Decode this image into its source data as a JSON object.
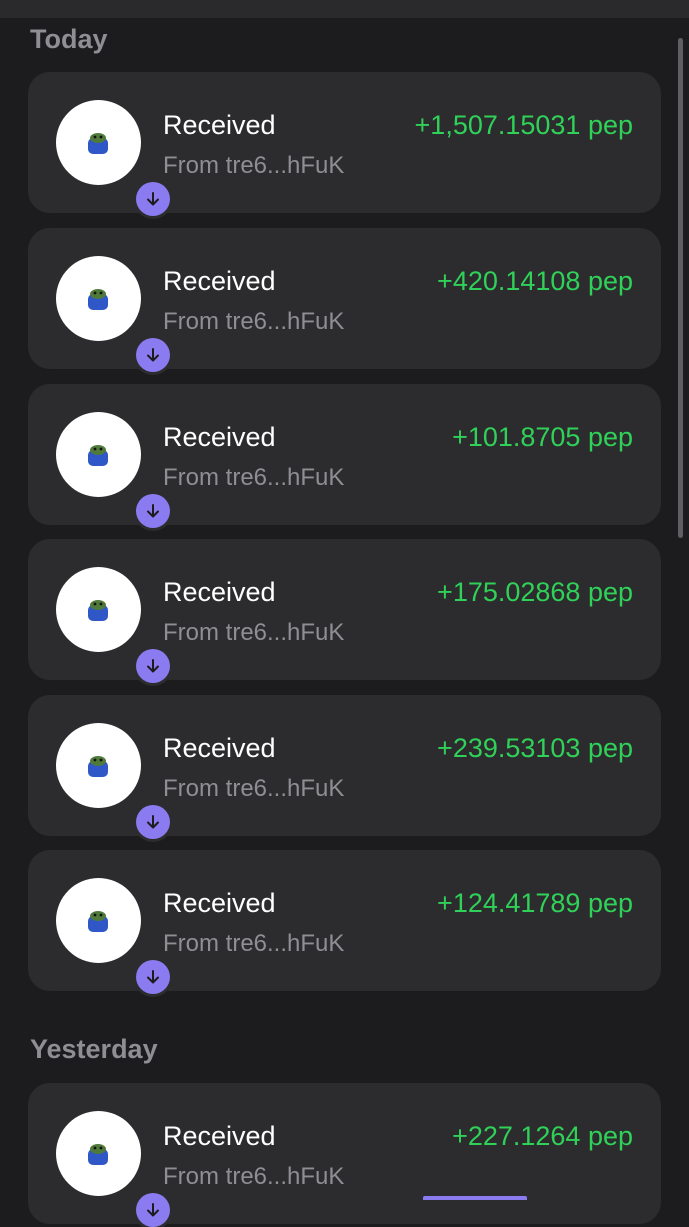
{
  "sections": [
    {
      "header": "Today",
      "transactions": [
        {
          "title": "Received",
          "from": "From tre6...hFuK",
          "amount": "+1,507.15031 pep",
          "icon": "receive-arrow-icon"
        },
        {
          "title": "Received",
          "from": "From tre6...hFuK",
          "amount": "+420.14108 pep",
          "icon": "receive-arrow-icon"
        },
        {
          "title": "Received",
          "from": "From tre6...hFuK",
          "amount": "+101.8705 pep",
          "icon": "receive-arrow-icon"
        },
        {
          "title": "Received",
          "from": "From tre6...hFuK",
          "amount": "+175.02868 pep",
          "icon": "receive-arrow-icon"
        },
        {
          "title": "Received",
          "from": "From tre6...hFuK",
          "amount": "+239.53103 pep",
          "icon": "receive-arrow-icon"
        },
        {
          "title": "Received",
          "from": "From tre6...hFuK",
          "amount": "+124.41789 pep",
          "icon": "receive-arrow-icon"
        }
      ]
    },
    {
      "header": "Yesterday",
      "transactions": [
        {
          "title": "Received",
          "from": "From tre6...hFuK",
          "amount": "+227.1264 pep",
          "icon": "receive-arrow-icon"
        }
      ]
    }
  ],
  "colors": {
    "background": "#1c1c1e",
    "card": "#2c2c2e",
    "amount_positive": "#30d158",
    "secondary_text": "#8e8e93",
    "badge": "#8a7cf0"
  }
}
